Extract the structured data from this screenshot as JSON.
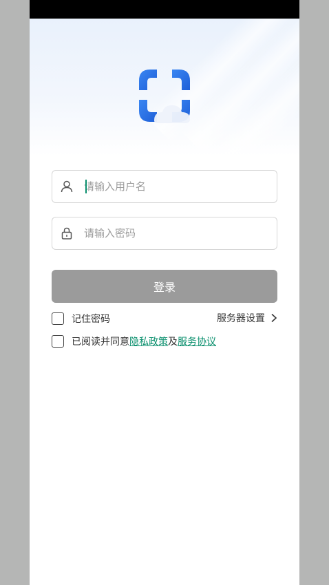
{
  "form": {
    "username_placeholder": "请输入用户名",
    "password_placeholder": "请输入密码",
    "login_label": "登录",
    "remember_label": "记住密码",
    "server_settings_label": "服务器设置"
  },
  "agreement": {
    "prefix": "已阅读并同意",
    "privacy_link": "隐私政策",
    "joiner": "及",
    "service_link": "服务协议"
  },
  "icons": {
    "user": "user-icon",
    "lock": "lock-icon",
    "chevron": "chevron-right-icon",
    "logo": "app-logo"
  },
  "colors": {
    "accent": "#0a8f6d",
    "brand_blue": "#2a6ee8",
    "button_disabled": "#9b9b9b"
  }
}
